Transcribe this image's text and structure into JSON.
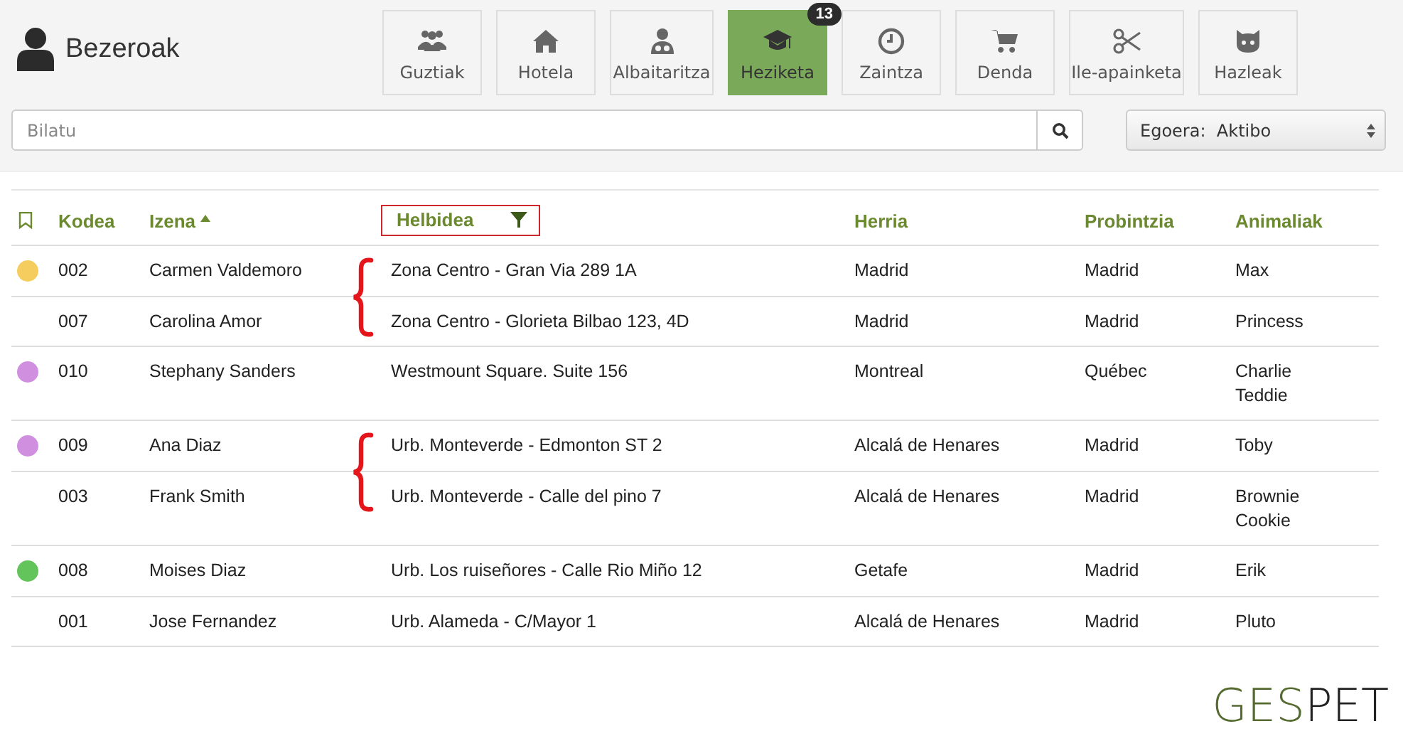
{
  "header": {
    "title": "Bezeroak"
  },
  "tabs": [
    {
      "label": "Guztiak",
      "selected": false
    },
    {
      "label": "Hotela",
      "selected": false
    },
    {
      "label": "Albaitaritza",
      "selected": false
    },
    {
      "label": "Heziketa",
      "selected": true,
      "badge": "13"
    },
    {
      "label": "Zaintza",
      "selected": false
    },
    {
      "label": "Denda",
      "selected": false
    },
    {
      "label": "Ile-apainketa",
      "selected": false
    },
    {
      "label": "Hazleak",
      "selected": false
    }
  ],
  "search": {
    "placeholder": "Bilatu"
  },
  "status_select": {
    "label": "Egoera:",
    "value": "Aktibo"
  },
  "table": {
    "columns": [
      {
        "label": "Kodea"
      },
      {
        "label": "Izena",
        "sorted_ascending": true
      },
      {
        "label": "Helbidea",
        "filter": true,
        "highlighted": true
      },
      {
        "label": "Herria"
      },
      {
        "label": "Probintzia"
      },
      {
        "label": "Animaliak"
      }
    ],
    "rows": [
      {
        "color": "#f5cd5f",
        "code": "002",
        "name": "Carmen Valdemoro",
        "address": "Zona Centro - Gran Via 289 1A",
        "town": "Madrid",
        "province": "Madrid",
        "animals": [
          "Max"
        ],
        "brace": true
      },
      {
        "code": "007",
        "name": "Carolina Amor",
        "address": "Zona Centro - Glorieta Bilbao 123, 4D",
        "town": "Madrid",
        "province": "Madrid",
        "animals": [
          "Princess"
        ],
        "brace": false
      },
      {
        "color": "#d18fdf",
        "code": "010",
        "name": "Stephany Sanders",
        "address": "Westmount Square. Suite 156",
        "town": "Montreal",
        "province": "Québec",
        "animals": [
          "Charlie",
          "Teddie"
        ],
        "brace": false
      },
      {
        "color": "#d18fdf",
        "code": "009",
        "name": "Ana Diaz",
        "address": "Urb. Monteverde - Edmonton ST 2",
        "town": "Alcalá de Henares",
        "province": "Madrid",
        "animals": [
          "Toby"
        ],
        "brace": true
      },
      {
        "code": "003",
        "name": "Frank Smith",
        "address": "Urb. Monteverde - Calle del pino 7",
        "town": "Alcalá de Henares",
        "province": "Madrid",
        "animals": [
          "Brownie",
          "Cookie"
        ],
        "brace": false
      },
      {
        "color": "#62c45a",
        "code": "008",
        "name": "Moises Diaz",
        "address": "Urb. Los ruiseñores - Calle Rio Miño 12",
        "town": "Getafe",
        "province": "Madrid",
        "animals": [
          "Erik"
        ],
        "brace": false
      },
      {
        "code": "001",
        "name": "Jose Fernandez",
        "address": "Urb. Alameda - C/Mayor 1",
        "town": "Alcalá de Henares",
        "province": "Madrid",
        "animals": [
          "Pluto"
        ],
        "brace": false
      }
    ]
  },
  "logo": {
    "lead": "GES",
    "tail": "PET"
  }
}
